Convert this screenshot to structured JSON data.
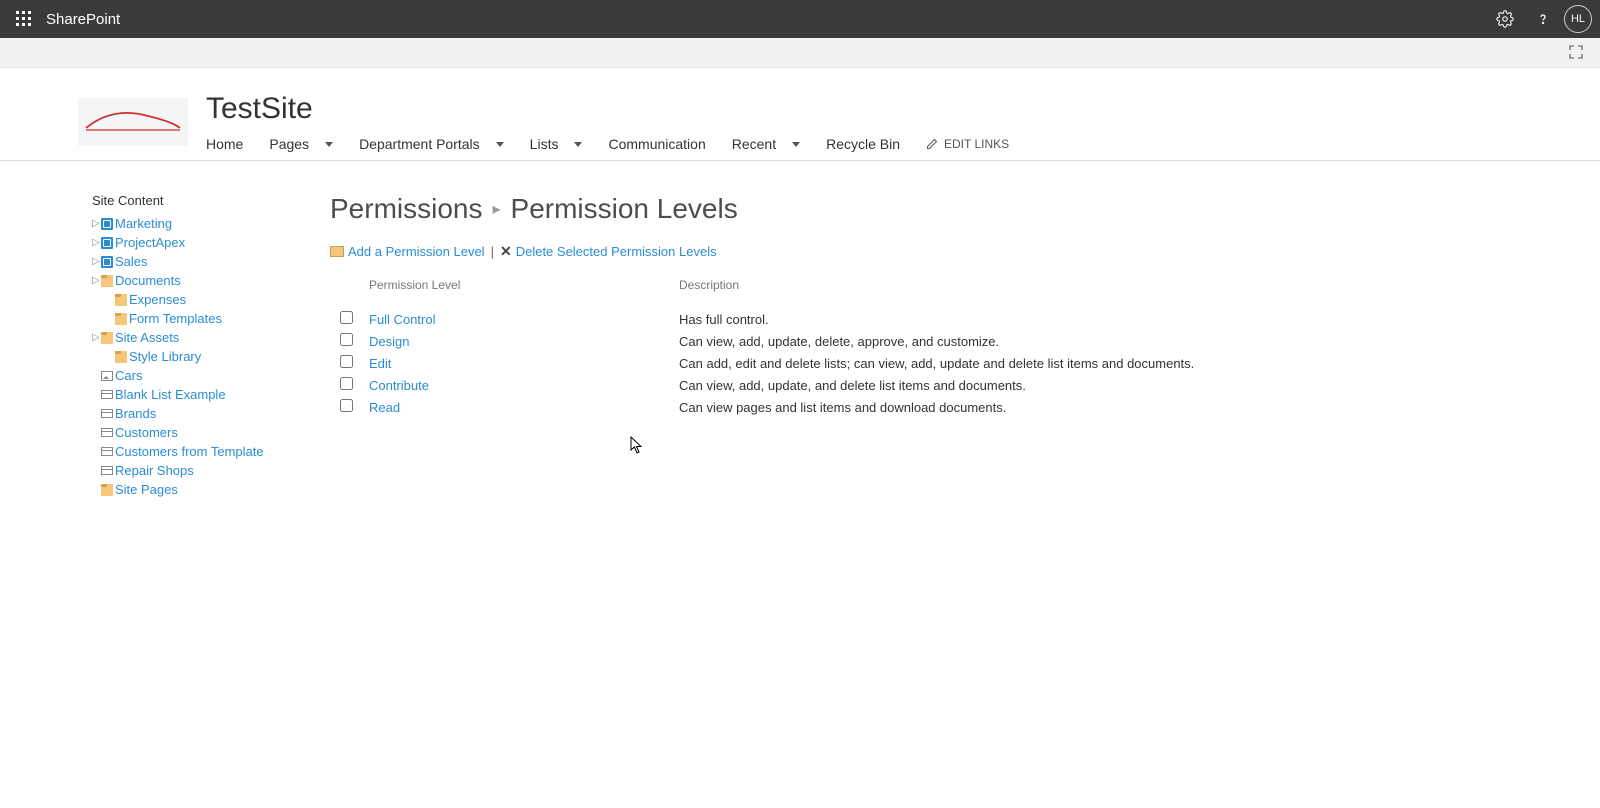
{
  "topbar": {
    "appname": "SharePoint",
    "avatar": "HL"
  },
  "site": {
    "title": "TestSite",
    "nav": {
      "home": "Home",
      "pages": "Pages",
      "dept": "Department Portals",
      "lists": "Lists",
      "comm": "Communication",
      "recent": "Recent",
      "recycle": "Recycle Bin",
      "editlinks": "EDIT LINKS"
    }
  },
  "tree": {
    "title": "Site Content",
    "items": [
      {
        "label": "Marketing",
        "type": "site",
        "expandable": true,
        "level": 1
      },
      {
        "label": "ProjectApex",
        "type": "site",
        "expandable": true,
        "level": 1
      },
      {
        "label": "Sales",
        "type": "site",
        "expandable": true,
        "level": 1
      },
      {
        "label": "Documents",
        "type": "lib",
        "expandable": true,
        "level": 1
      },
      {
        "label": "Expenses",
        "type": "lib",
        "expandable": false,
        "level": 2
      },
      {
        "label": "Form Templates",
        "type": "lib",
        "expandable": false,
        "level": 2
      },
      {
        "label": "Site Assets",
        "type": "lib",
        "expandable": true,
        "level": 1
      },
      {
        "label": "Style Library",
        "type": "lib",
        "expandable": false,
        "level": 2
      },
      {
        "label": "Cars",
        "type": "img",
        "expandable": false,
        "level": 1
      },
      {
        "label": "Blank List Example",
        "type": "list",
        "expandable": false,
        "level": 1
      },
      {
        "label": "Brands",
        "type": "list",
        "expandable": false,
        "level": 1
      },
      {
        "label": "Customers",
        "type": "list",
        "expandable": false,
        "level": 1
      },
      {
        "label": "Customers from Template",
        "type": "list",
        "expandable": false,
        "level": 1
      },
      {
        "label": "Repair Shops",
        "type": "list",
        "expandable": false,
        "level": 1
      },
      {
        "label": "Site Pages",
        "type": "lib",
        "expandable": false,
        "level": 1
      }
    ]
  },
  "main": {
    "bc_root": "Permissions",
    "bc_current": "Permission Levels",
    "toolbar": {
      "add": "Add a Permission Level",
      "delete": "Delete Selected Permission Levels"
    },
    "columns": {
      "name": "Permission Level",
      "desc": "Description"
    },
    "rows": [
      {
        "name": "Full Control",
        "desc": "Has full control."
      },
      {
        "name": "Design",
        "desc": "Can view, add, update, delete, approve, and customize."
      },
      {
        "name": "Edit",
        "desc": "Can add, edit and delete lists; can view, add, update and delete list items and documents."
      },
      {
        "name": "Contribute",
        "desc": "Can view, add, update, and delete list items and documents."
      },
      {
        "name": "Read",
        "desc": "Can view pages and list items and download documents."
      }
    ]
  }
}
